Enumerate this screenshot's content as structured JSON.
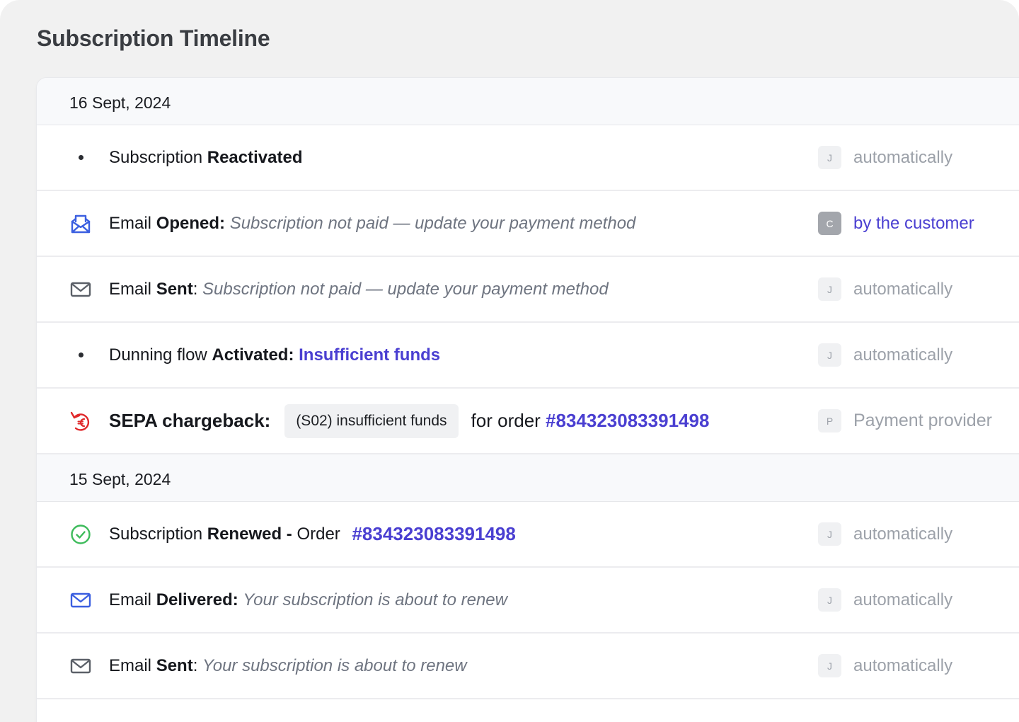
{
  "page": {
    "title": "Subscription Timeline"
  },
  "groups": [
    {
      "date": "16 Sept, 2024",
      "events": [
        {
          "icon": "bullet-dot",
          "text": "Subscription ",
          "bold": "Reactivated",
          "avatar": "J",
          "actor": "automatically"
        },
        {
          "icon": "envelope-open-icon",
          "text": "Email ",
          "bold": "Opened:",
          "detail": "Subscription not paid — update your payment method",
          "avatar": "C",
          "actor": "by the customer"
        },
        {
          "icon": "envelope-icon",
          "text": "Email ",
          "bold": "Sent",
          "sep": ": ",
          "detail": "Subscription not paid — update your payment method",
          "avatar": "J",
          "actor": "automatically"
        },
        {
          "icon": "bullet-dot",
          "text": "Dunning flow ",
          "bold": "Activated:",
          "link": "Insufficient funds",
          "avatar": "J",
          "actor": "automatically"
        },
        {
          "icon": "euro-refund-icon",
          "bold": "SEPA chargeback:",
          "reason": "(S02) insufficient funds",
          "suffix": "for order ",
          "link": "#834323083391498",
          "avatar": "P",
          "actor": "Payment provider"
        }
      ]
    },
    {
      "date": "15 Sept, 2024",
      "events": [
        {
          "icon": "check-circle-icon",
          "text": "Subscription ",
          "bold": "Renewed - ",
          "suffix": "Order ",
          "link": "#834323083391498",
          "avatar": "J",
          "actor": "automatically"
        },
        {
          "icon": "envelope-icon",
          "text": "Email ",
          "bold": "Delivered:",
          "detail": "Your subscription is about to renew",
          "avatar": "J",
          "actor": "automatically"
        },
        {
          "icon": "envelope-icon",
          "text": "Email ",
          "bold": "Sent",
          "sep": ": ",
          "detail": "Your subscription is about to renew",
          "avatar": "J",
          "actor": "automatically"
        }
      ]
    }
  ],
  "colors": {
    "link": "#4a3fd1",
    "envelope_blue": "#3b5fe0",
    "envelope_gray": "#5b6068",
    "check_green": "#3dbb5b",
    "refund_red": "#e0282a"
  }
}
